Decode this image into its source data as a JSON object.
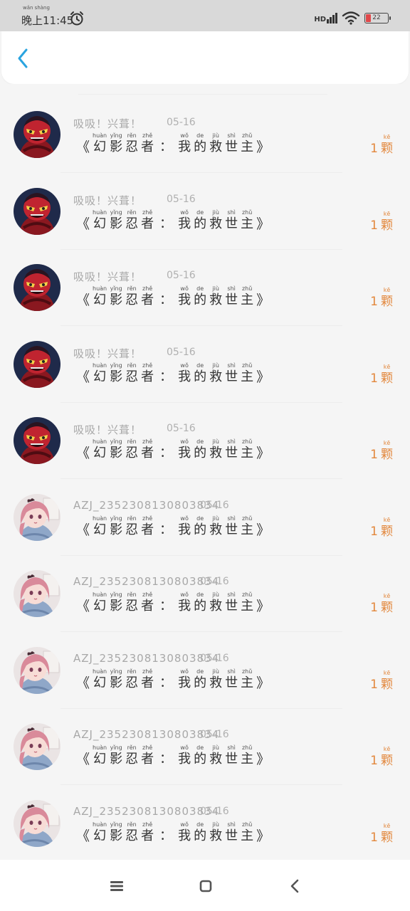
{
  "status_bar": {
    "time_pinyin": "wǎn shàng",
    "time": "晚上11:45",
    "network": "HD",
    "battery": "22"
  },
  "header": {
    "back_icon": "chevron-left-icon",
    "accent_color": "#2aa4e0"
  },
  "colors": {
    "amount": "#e2873c",
    "background": "#f5f5f5"
  },
  "records": [
    {
      "user": "吸吸！兴葺！",
      "date": "05-16",
      "avatar": "red-masked-character",
      "amount": "1"
    },
    {
      "user": "吸吸！兴葺！",
      "date": "05-16",
      "avatar": "red-masked-character",
      "amount": "1"
    },
    {
      "user": "吸吸！兴葺！",
      "date": "05-16",
      "avatar": "red-masked-character",
      "amount": "1"
    },
    {
      "user": "吸吸！兴葺！",
      "date": "05-16",
      "avatar": "red-masked-character",
      "amount": "1"
    },
    {
      "user": "吸吸！兴葺！",
      "date": "05-16",
      "avatar": "red-masked-character",
      "amount": "1"
    },
    {
      "user": "AZJ_2352308130803834",
      "date": "05-16",
      "avatar": "pink-haired-girl",
      "amount": "1"
    },
    {
      "user": "AZJ_2352308130803834",
      "date": "05-16",
      "avatar": "pink-haired-girl",
      "amount": "1"
    },
    {
      "user": "AZJ_2352308130803834",
      "date": "05-16",
      "avatar": "pink-haired-girl",
      "amount": "1"
    },
    {
      "user": "AZJ_2352308130803834",
      "date": "05-16",
      "avatar": "pink-haired-girl",
      "amount": "1"
    },
    {
      "user": "AZJ_2352308130803834",
      "date": "05-16",
      "avatar": "pink-haired-girl",
      "amount": "1"
    }
  ],
  "book": {
    "open_bracket": "《",
    "close_bracket": "》",
    "colon": "：",
    "chars_a": [
      {
        "py": "huàn",
        "hz": "幻"
      },
      {
        "py": "yǐng",
        "hz": "影"
      },
      {
        "py": "rěn",
        "hz": "忍"
      },
      {
        "py": "zhě",
        "hz": "者"
      }
    ],
    "chars_b": [
      {
        "py": "wǒ",
        "hz": "我"
      },
      {
        "py": "de",
        "hz": "的"
      },
      {
        "py": "jiù",
        "hz": "救"
      },
      {
        "py": "shì",
        "hz": "世"
      },
      {
        "py": "zhǔ",
        "hz": "主"
      }
    ]
  },
  "amount_unit": {
    "py": "kē",
    "hz": "颗"
  },
  "nav": {
    "menu_icon": "menu-icon",
    "home_icon": "home-square-icon",
    "back_icon": "back-triangle-icon"
  }
}
